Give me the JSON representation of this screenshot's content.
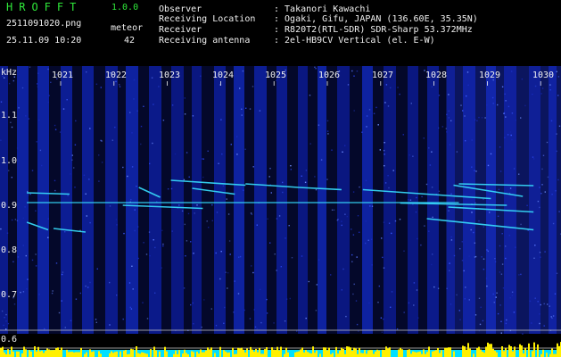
{
  "header": {
    "app_title": "HROFFT",
    "version": "1.0.0",
    "filename": "2511091020.png",
    "meteor_label": "meteor",
    "datetime": "25.11.09 10:20",
    "meteor_count": "42"
  },
  "info": [
    {
      "label": "Observer",
      "value": ": Takanori Kawachi"
    },
    {
      "label": "Receiving Location",
      "value": ": Ogaki, Gifu, JAPAN (136.60E, 35.35N)"
    },
    {
      "label": "Receiver",
      "value": ": R820T2(RTL-SDR) SDR-Sharp 53.372MHz"
    },
    {
      "label": "Receiving antenna",
      "value": ": 2el-HB9CV Vertical (el. E-W)"
    }
  ],
  "colors": {
    "text_green": "#2fe83a",
    "text_white": "#f0f0f0",
    "background": "#000000",
    "spectrogram_low": "#0a1a8c",
    "echo": "#38e0ff",
    "histogram": "#fff000",
    "histogram_base": "#00e0ff"
  },
  "chart_data": {
    "type": "heatmap",
    "y_unit": "kHz",
    "x_ticks": [
      "1021",
      "1022",
      "1023",
      "1024",
      "1025",
      "1026",
      "1027",
      "1028",
      "1029",
      "1030"
    ],
    "y_ticks": [
      "1.1",
      "1.0",
      "0.9",
      "0.8",
      "0.7",
      "0.6"
    ],
    "y_tick_values": [
      1.1,
      1.0,
      0.9,
      0.8,
      0.7,
      0.6
    ],
    "ylim": [
      0.58,
      1.17
    ],
    "xlim": [
      1020.5,
      1030
    ],
    "trails": [
      {
        "x": [
          1020.5,
          1021.3
        ],
        "y": [
          0.928,
          0.925
        ]
      },
      {
        "x": [
          1020.5,
          1028.6
        ],
        "y": [
          0.906,
          0.906
        ]
      },
      {
        "x": [
          1020.5,
          1020.9
        ],
        "y": [
          0.862,
          0.845
        ]
      },
      {
        "x": [
          1021.0,
          1021.6
        ],
        "y": [
          0.848,
          0.84
        ]
      },
      {
        "x": [
          1022.6,
          1023.0
        ],
        "y": [
          0.94,
          0.918
        ]
      },
      {
        "x": [
          1023.2,
          1024.6
        ],
        "y": [
          0.956,
          0.945
        ]
      },
      {
        "x": [
          1023.6,
          1024.4
        ],
        "y": [
          0.938,
          0.925
        ]
      },
      {
        "x": [
          1024.6,
          1025.6
        ],
        "y": [
          0.948,
          0.94
        ]
      },
      {
        "x": [
          1025.6,
          1026.4
        ],
        "y": [
          0.94,
          0.935
        ]
      },
      {
        "x": [
          1026.8,
          1029.2
        ],
        "y": [
          0.935,
          0.915
        ]
      },
      {
        "x": [
          1028.6,
          1030.0
        ],
        "y": [
          0.948,
          0.944
        ]
      },
      {
        "x": [
          1028.5,
          1029.8
        ],
        "y": [
          0.945,
          0.92
        ]
      },
      {
        "x": [
          1027.5,
          1029.5
        ],
        "y": [
          0.905,
          0.9
        ]
      },
      {
        "x": [
          1028.4,
          1030.0
        ],
        "y": [
          0.896,
          0.885
        ]
      },
      {
        "x": [
          1028.0,
          1030.0
        ],
        "y": [
          0.87,
          0.845
        ]
      },
      {
        "x": [
          1022.3,
          1023.8
        ],
        "y": [
          0.9,
          0.893
        ]
      }
    ]
  }
}
